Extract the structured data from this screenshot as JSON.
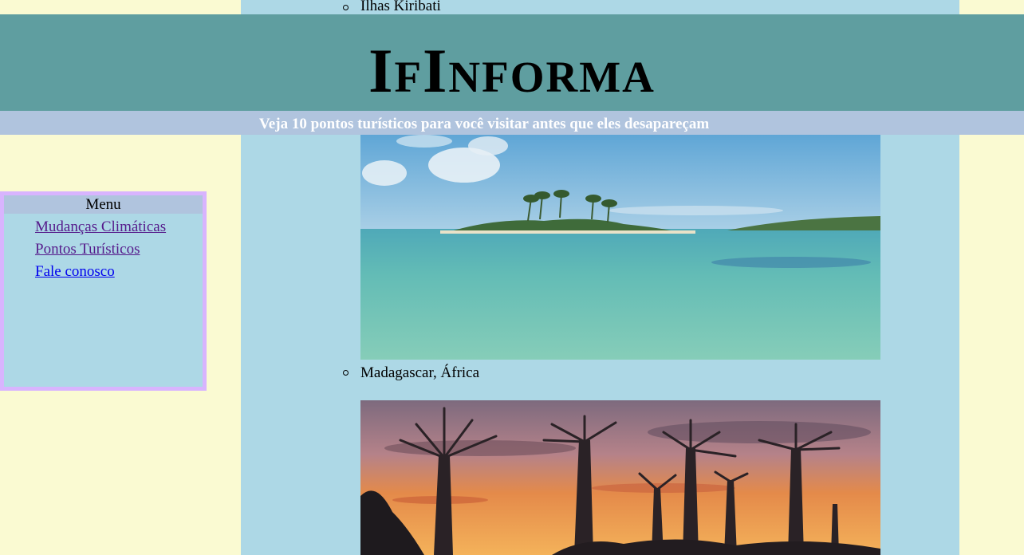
{
  "header": {
    "title": "IfInforma",
    "subtitle": "Veja 10 pontos turísticos para você visitar antes que eles desapareçam"
  },
  "menu": {
    "title": "Menu",
    "items": [
      {
        "label": "Mudanças Climáticas",
        "state": "visited"
      },
      {
        "label": "Pontos Turísticos",
        "state": "visited"
      },
      {
        "label": "Fale conosco",
        "state": "unvisited"
      }
    ]
  },
  "main": {
    "destinations": [
      {
        "label": "Ilhas Kiribati",
        "image": "tropical-island-lagoon-photo"
      },
      {
        "label": "Madagascar, África",
        "image": "baobab-trees-sunset-photo"
      }
    ]
  },
  "colors": {
    "page_background": "#fafad2",
    "content_background": "#add8e6",
    "header_background": "#5f9ea0",
    "subheader_background": "#b0c4de",
    "menu_border": "#d8b4fe",
    "visited_link": "#551a8b",
    "unvisited_link": "#0000ee"
  }
}
